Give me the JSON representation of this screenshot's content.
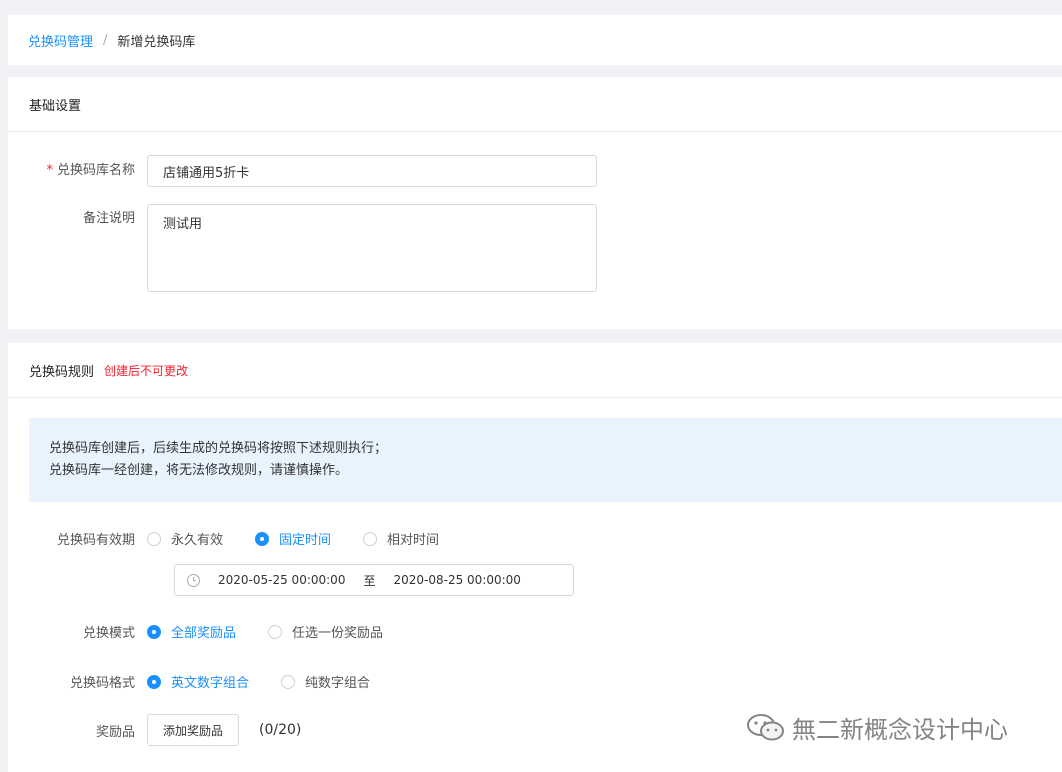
{
  "breadcrumb": {
    "parent": "兑换码管理",
    "separator": "/",
    "current": "新增兑换码库"
  },
  "basic": {
    "title": "基础设置",
    "name_label": "兑换码库名称",
    "name_required": "*",
    "name_value": "店铺通用5折卡",
    "remark_label": "备注说明",
    "remark_value": "测试用"
  },
  "rules": {
    "title": "兑换码规则",
    "warning": "创建后不可更改",
    "notice_line1": "兑换码库创建后，后续生成的兑换码将按照下述规则执行；",
    "notice_line2": "兑换码库一经创建，将无法修改规则，请谨慎操作。",
    "validity_label": "兑换码有效期",
    "validity_options": [
      "永久有效",
      "固定时间",
      "相对时间"
    ],
    "validity_selected": 1,
    "date_start": "2020-05-25 00:00:00",
    "date_sep": "至",
    "date_end": "2020-08-25 00:00:00",
    "mode_label": "兑换模式",
    "mode_options": [
      "全部奖励品",
      "任选一份奖励品"
    ],
    "mode_selected": 0,
    "format_label": "兑换码格式",
    "format_options": [
      "英文数字组合",
      "纯数字组合"
    ],
    "format_selected": 0,
    "reward_label": "奖励品",
    "add_reward_button": "添加奖励品",
    "reward_count": "(0/20)"
  },
  "watermark": {
    "text": "無二新概念设计中心",
    "icon": "wechat-icon"
  },
  "colors": {
    "primary": "#1890ff",
    "danger": "#f5222d",
    "notice_bg": "#e8f3fe"
  }
}
